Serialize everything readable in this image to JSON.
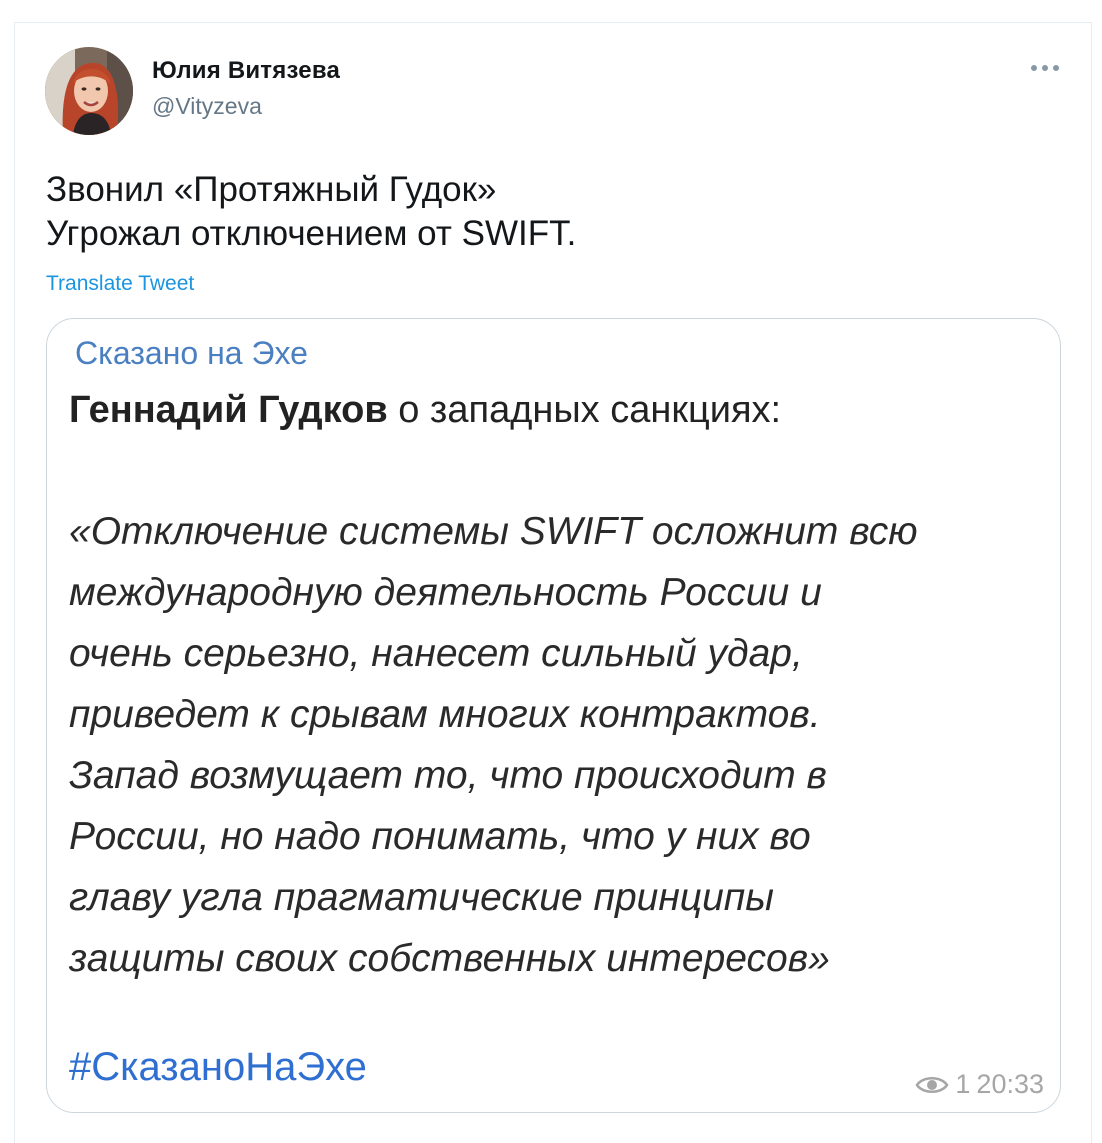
{
  "tweet": {
    "author_name": "Юлия Витязева",
    "author_handle": "@Vityzeva",
    "text_lines": [
      "Звонил «Протяжный Гудок»",
      "Угрожал отключением от SWIFT."
    ],
    "translate_label": "Translate Tweet"
  },
  "media": {
    "channel_name": "Сказано на Эхе",
    "headline_bold": "Геннадий Гудков",
    "headline_rest": " о западных санкциях:",
    "quote_lines": [
      "«Отключение системы SWIFT осложнит всю",
      "международную деятельность России и",
      "очень серьезно, нанесет сильный удар,",
      "приведет к срывам многих контрактов.",
      "Запад возмущает то, что происходит в",
      "России, но надо понимать, что у них во",
      "главу угла прагматические принципы",
      "защиты своих собственных интересов»"
    ],
    "hashtag": "#СказаноНаЭхе",
    "views": "1",
    "time": "20:33"
  },
  "icons": {
    "more": "more-dots-icon",
    "views": "eye-icon"
  },
  "colors": {
    "link": "#1b95e0",
    "channel": "#4a7fc1",
    "hashtag": "#2f6fd1",
    "handle": "#657786"
  }
}
